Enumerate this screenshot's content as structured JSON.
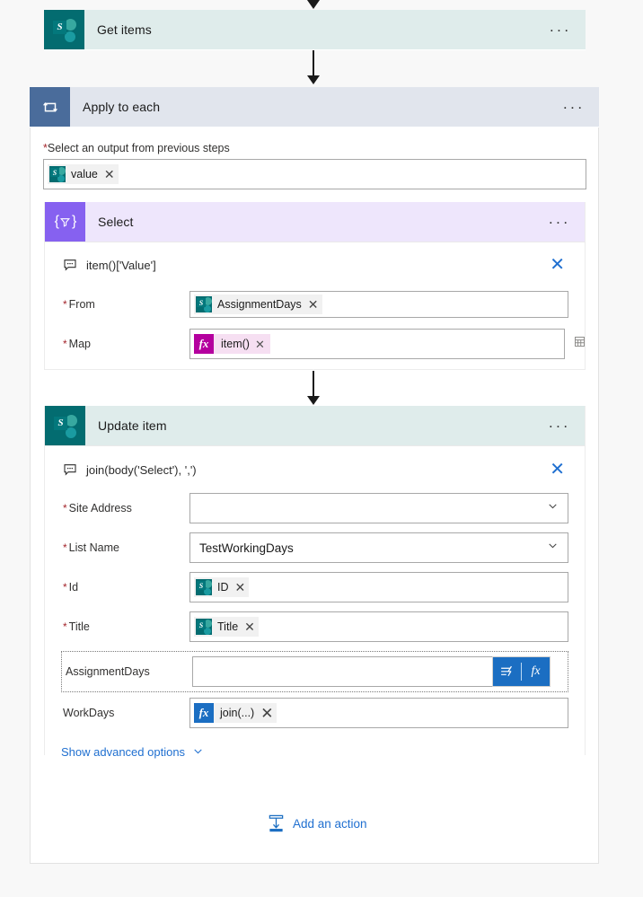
{
  "flow": {
    "get_items": {
      "title": "Get items",
      "icon": "sharepoint-icon",
      "menu": "···"
    },
    "apply_to_each": {
      "title": "Apply to each",
      "icon": "loop-icon",
      "menu": "···",
      "output_label": "Select an output from previous steps",
      "output_token": {
        "label": "value",
        "icon": "sharepoint-icon",
        "remove": "✕"
      }
    },
    "select_action": {
      "title": "Select",
      "icon": "select-filter-icon",
      "menu": "···",
      "comment": "item()['Value']",
      "comment_icon": "comment-icon",
      "close": "✕",
      "fields": [
        {
          "label": "From",
          "required": true,
          "token": {
            "label": "AssignmentDays",
            "icon": "sharepoint-icon",
            "remove": "✕",
            "kind": "sharepoint"
          }
        },
        {
          "label": "Map",
          "required": true,
          "token": {
            "label": "item()",
            "icon": "fx-icon",
            "badge": "fx",
            "remove": "✕",
            "kind": "expression-pink"
          },
          "side_icon": "table-grid-icon"
        }
      ]
    },
    "update_item": {
      "title": "Update item",
      "icon": "sharepoint-icon",
      "menu": "···",
      "comment": "join(body('Select'), ',')",
      "comment_icon": "comment-icon",
      "close": "✕",
      "fields": [
        {
          "label": "Site Address",
          "required": true,
          "type": "dropdown",
          "value": "",
          "chevron": "chevron-down-icon"
        },
        {
          "label": "List Name",
          "required": true,
          "type": "dropdown",
          "value": "TestWorkingDays",
          "chevron": "chevron-down-icon"
        },
        {
          "label": "Id",
          "required": true,
          "type": "token",
          "token": {
            "label": "ID",
            "icon": "sharepoint-icon",
            "remove": "✕",
            "kind": "sharepoint"
          }
        },
        {
          "label": "Title",
          "required": true,
          "type": "token",
          "token": {
            "label": "Title",
            "icon": "sharepoint-icon",
            "remove": "✕",
            "kind": "sharepoint"
          }
        },
        {
          "label": "AssignmentDays",
          "required": false,
          "type": "text",
          "value": "",
          "focused": true,
          "buttons": {
            "dynamic_content": "dynamic-content-icon",
            "expression": "fx"
          }
        },
        {
          "label": "WorkDays",
          "required": false,
          "type": "token",
          "token": {
            "label": "join(...)",
            "icon": "fx-icon",
            "badge": "fx",
            "remove": "✕",
            "kind": "expression-blue"
          }
        }
      ],
      "advanced_link": "Show advanced options",
      "advanced_chevron": "chevron-down-icon"
    },
    "add_action": {
      "label": "Add an action",
      "icon": "add-action-icon"
    }
  },
  "colors": {
    "sharepoint_teal": "#036c70",
    "header_teal": "#dfeceb",
    "loop_blue": "#4a6c9b",
    "header_loop": "#e1e5ed",
    "select_purple": "#8661f0",
    "header_select": "#eee6fc",
    "link_blue": "#1f6fd0",
    "accent_blue": "#1b6ec2",
    "required_red": "#a4262c",
    "expression_pink": "#b4009e",
    "page_bg": "#f8f8f8"
  }
}
